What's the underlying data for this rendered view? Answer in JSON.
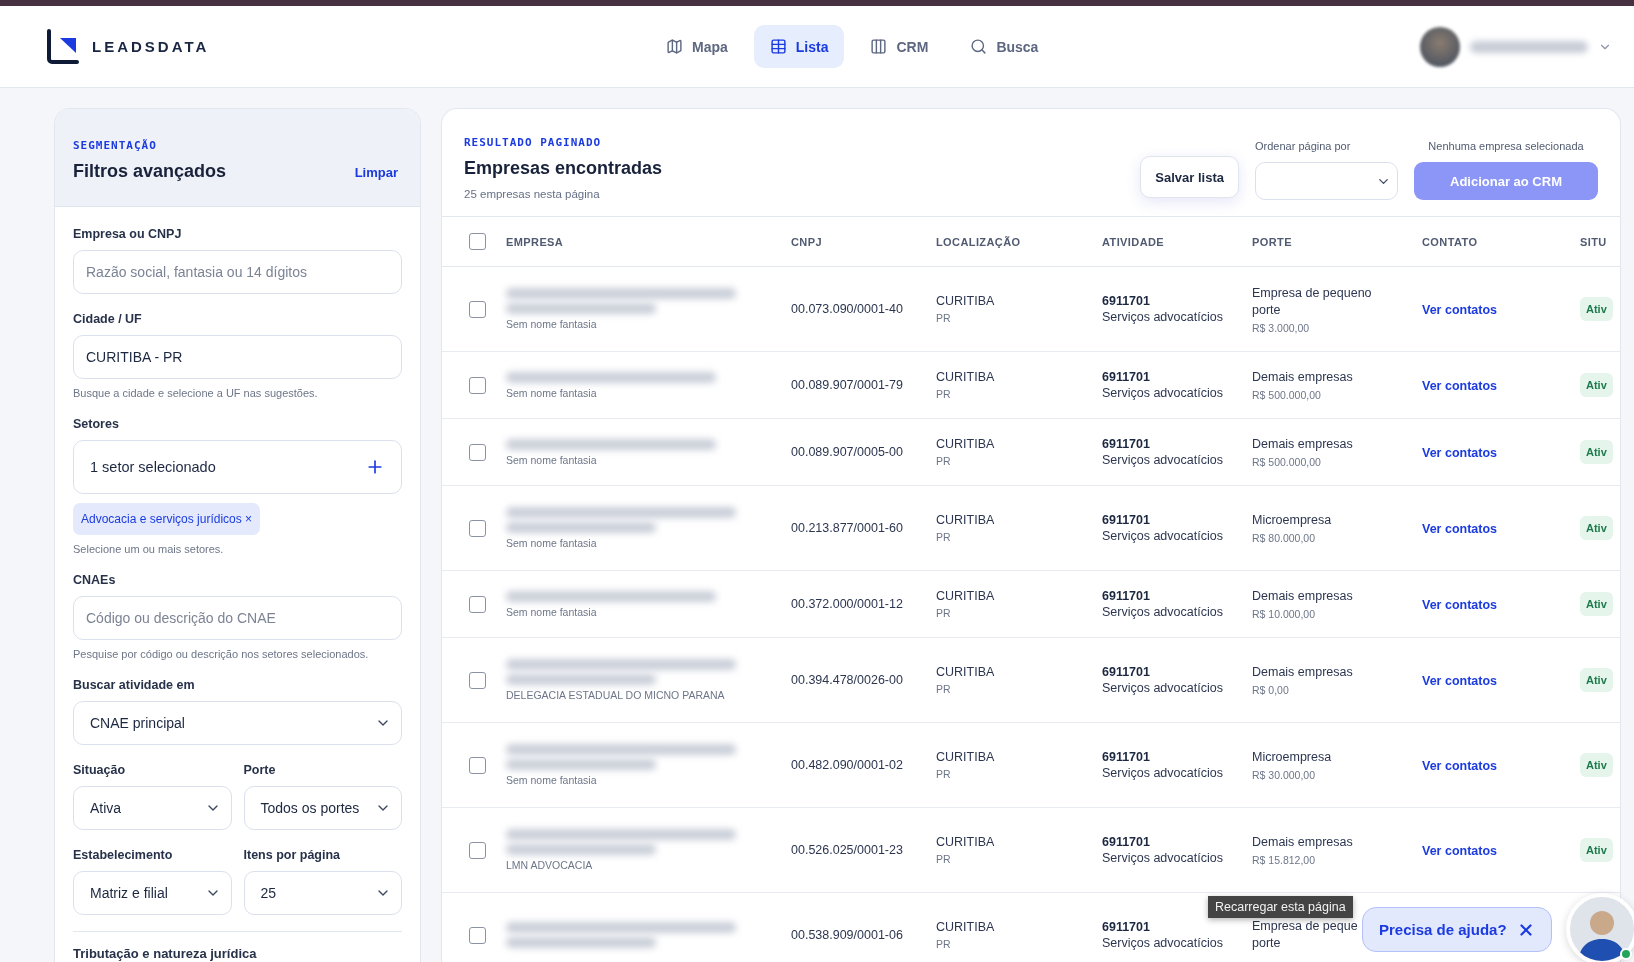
{
  "header": {
    "logo": "LEADSDATA",
    "nav": [
      {
        "label": "Mapa",
        "kind": "map",
        "selected": false
      },
      {
        "label": "Lista",
        "kind": "list",
        "selected": true
      },
      {
        "label": "CRM",
        "kind": "kanban",
        "selected": false
      },
      {
        "label": "Busca",
        "kind": "search",
        "selected": false
      }
    ]
  },
  "filters": {
    "eyebrow": "SEGMENTAÇÃO",
    "title": "Filtros avançados",
    "clear": "Limpar",
    "rows": [
      [
        {
          "kind": "text",
          "label": "Empresa ou CNPJ",
          "placeholder": "Razão social, fantasia ou 14 dígitos"
        }
      ],
      [
        {
          "kind": "text",
          "label": "Cidade / UF",
          "value": "CURITIBA - PR",
          "hint": "Busque a cidade e selecione a UF nas sugestões."
        }
      ],
      [
        {
          "kind": "multi",
          "label": "Setores",
          "value": "1 setor selecionado",
          "chips": [
            {
              "label": "Advocacia e serviços jurídicos",
              "remove": "×"
            }
          ],
          "hint": "Selecione um ou mais setores."
        }
      ],
      [
        {
          "kind": "text",
          "label": "CNAEs",
          "placeholder": "Código ou descrição do CNAE",
          "hint": "Pesquise por código ou descrição nos setores selecionados."
        }
      ],
      [
        {
          "kind": "select",
          "label": "Buscar atividade em",
          "value": "CNAE principal"
        }
      ],
      [
        {
          "kind": "select",
          "label": "Situação",
          "value": "Ativa"
        },
        {
          "kind": "select",
          "label": "Porte",
          "value": "Todos os portes"
        }
      ],
      [
        {
          "kind": "select",
          "label": "Estabelecimento",
          "value": "Matriz e filial"
        },
        {
          "kind": "select",
          "label": "Itens por página",
          "value": "25"
        }
      ]
    ],
    "section": "Tributação e natureza jurídica"
  },
  "results": {
    "eyebrow": "RESULTADO PAGINADO",
    "title": "Empresas encontradas",
    "subtitle": "25 empresas nesta página",
    "save": "Salvar lista",
    "sort_label": "Ordenar página por",
    "selection_note": "Nenhuma empresa selecionada",
    "add": {
      "label": "Adicionar ao CRM",
      "disabled": true
    },
    "table": {
      "select_all": {
        "checked": false
      },
      "columns": [
        "EMPRESA",
        "CNPJ",
        "LOCALIZAÇÃO",
        "ATIVIDADE",
        "PORTE",
        "CONTATO",
        "SITU"
      ],
      "rows": [
        {
          "checked": false,
          "kind": "long_name",
          "trade_name": "Sem nome fantasia",
          "cnpj": "00.073.090/0001-40",
          "city": "CURITIBA",
          "uf": "PR",
          "cnae": "6911701",
          "activity": "Serviços advocatícios",
          "size": "Empresa de pequeno porte",
          "revenue": "R$ 3.000,00",
          "contact": "Ver contatos",
          "status": "Ativ"
        },
        {
          "checked": false,
          "kind": "short_name",
          "trade_name": "Sem nome fantasia",
          "cnpj": "00.089.907/0001-79",
          "city": "CURITIBA",
          "uf": "PR",
          "cnae": "6911701",
          "activity": "Serviços advocatícios",
          "size": "Demais empresas",
          "revenue": "R$ 500.000,00",
          "contact": "Ver contatos",
          "status": "Ativ"
        },
        {
          "checked": false,
          "kind": "short_name",
          "trade_name": "Sem nome fantasia",
          "cnpj": "00.089.907/0005-00",
          "city": "CURITIBA",
          "uf": "PR",
          "cnae": "6911701",
          "activity": "Serviços advocatícios",
          "size": "Demais empresas",
          "revenue": "R$ 500.000,00",
          "contact": "Ver contatos",
          "status": "Ativ"
        },
        {
          "checked": false,
          "kind": "long_name",
          "trade_name": "Sem nome fantasia",
          "cnpj": "00.213.877/0001-60",
          "city": "CURITIBA",
          "uf": "PR",
          "cnae": "6911701",
          "activity": "Serviços advocatícios",
          "size": "Microempresa",
          "revenue": "R$ 80.000,00",
          "contact": "Ver contatos",
          "status": "Ativ"
        },
        {
          "checked": false,
          "kind": "short_name",
          "trade_name": "Sem nome fantasia",
          "cnpj": "00.372.000/0001-12",
          "city": "CURITIBA",
          "uf": "PR",
          "cnae": "6911701",
          "activity": "Serviços advocatícios",
          "size": "Demais empresas",
          "revenue": "R$ 10.000,00",
          "contact": "Ver contatos",
          "status": "Ativ"
        },
        {
          "checked": false,
          "kind": "long_name",
          "trade_name": "DELEGACIA ESTADUAL DO MICNO PARANA",
          "cnpj": "00.394.478/0026-00",
          "city": "CURITIBA",
          "uf": "PR",
          "cnae": "6911701",
          "activity": "Serviços advocatícios",
          "size": "Demais empresas",
          "revenue": "R$ 0,00",
          "contact": "Ver contatos",
          "status": "Ativ"
        },
        {
          "checked": false,
          "kind": "long_name",
          "trade_name": "Sem nome fantasia",
          "cnpj": "00.482.090/0001-02",
          "city": "CURITIBA",
          "uf": "PR",
          "cnae": "6911701",
          "activity": "Serviços advocatícios",
          "size": "Microempresa",
          "revenue": "R$ 30.000,00",
          "contact": "Ver contatos",
          "status": "Ativ"
        },
        {
          "checked": false,
          "kind": "long_name",
          "trade_name": "LMN ADVOCACIA",
          "cnpj": "00.526.025/0001-23",
          "city": "CURITIBA",
          "uf": "PR",
          "cnae": "6911701",
          "activity": "Serviços advocatícios",
          "size": "Demais empresas",
          "revenue": "R$ 15.812,00",
          "contact": "Ver contatos",
          "status": "Ativ"
        },
        {
          "checked": false,
          "kind": "long_name",
          "cnpj": "00.538.909/0001-06",
          "city": "CURITIBA",
          "uf": "PR",
          "cnae": "6911701",
          "activity": "Serviços advocatícios",
          "size": "Empresa de peque porte"
        }
      ]
    }
  },
  "tooltip": "Recarregar esta página",
  "help": {
    "label": "Precisa de ajuda?",
    "online": true
  }
}
